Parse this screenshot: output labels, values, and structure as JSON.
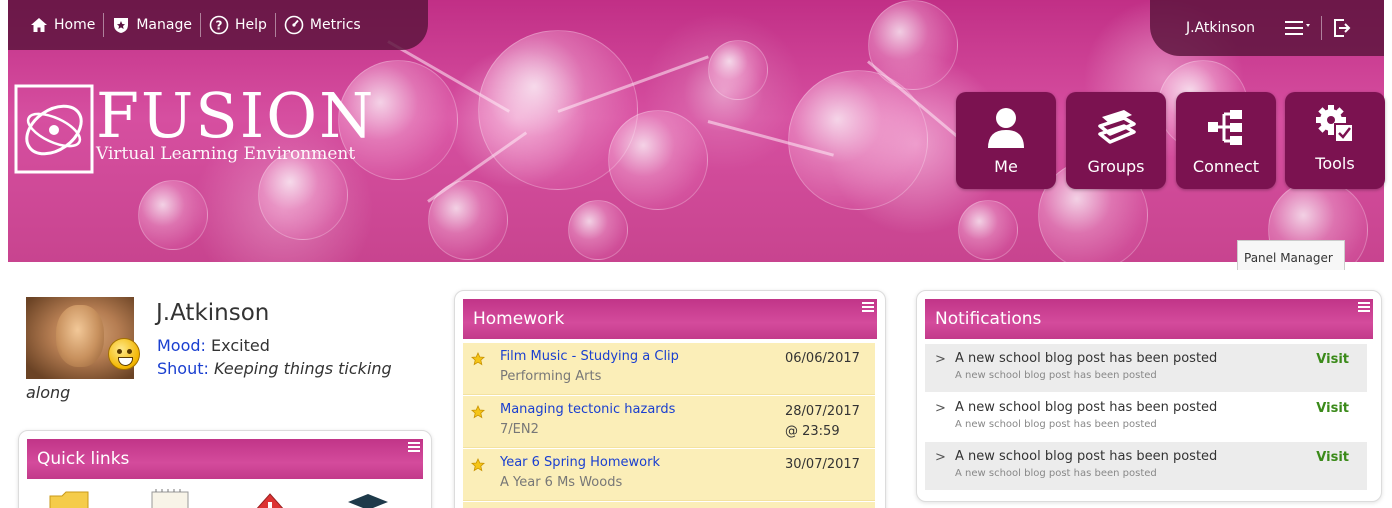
{
  "nav": {
    "home": "Home",
    "manage": "Manage",
    "help": "Help",
    "metrics": "Metrics",
    "user": "J.Atkinson"
  },
  "logo": {
    "title": "FUSION",
    "subtitle": "Virtual Learning Environment"
  },
  "tiles": [
    {
      "label": "Me",
      "icon": "person-icon"
    },
    {
      "label": "Groups",
      "icon": "books-icon"
    },
    {
      "label": "Connect",
      "icon": "sitemap-icon"
    },
    {
      "label": "Tools",
      "icon": "gear-icon"
    }
  ],
  "panel_manager": "Panel Manager",
  "profile": {
    "name": "J.Atkinson",
    "mood_label": "Mood:",
    "mood_value": "Excited",
    "shout_label": "Shout:",
    "shout_value": "Keeping things ticking",
    "shout_wrap": "along"
  },
  "quick_links": {
    "title": "Quick links"
  },
  "homework": {
    "title": "Homework",
    "items": [
      {
        "title": "Film Music - Studying a Clip",
        "subject": "Performing Arts",
        "date": "06/06/2017",
        "time": ""
      },
      {
        "title": "Managing tectonic hazards",
        "subject": "7/EN2",
        "date": "28/07/2017",
        "time": "@ 23:59"
      },
      {
        "title": "Year 6 Spring Homework",
        "subject": "A Year 6 Ms Woods",
        "date": "30/07/2017",
        "time": ""
      }
    ]
  },
  "notifications": {
    "title": "Notifications",
    "items": [
      {
        "title": "A new school blog post has been posted",
        "sub": "A new school blog post has been posted",
        "action": "Visit"
      },
      {
        "title": "A new school blog post has been posted",
        "sub": "A new school blog post has been posted",
        "action": "Visit"
      },
      {
        "title": "A new school blog post has been posted",
        "sub": "A new school blog post has been posted",
        "action": "Visit"
      }
    ]
  },
  "colors": {
    "banner": "#c12f86",
    "tile": "#7b1250",
    "widget_header": "#c13588",
    "homework_row": "#fbeeb8",
    "link_blue": "#1a3fd0",
    "visit_green": "#3b8a1a"
  }
}
